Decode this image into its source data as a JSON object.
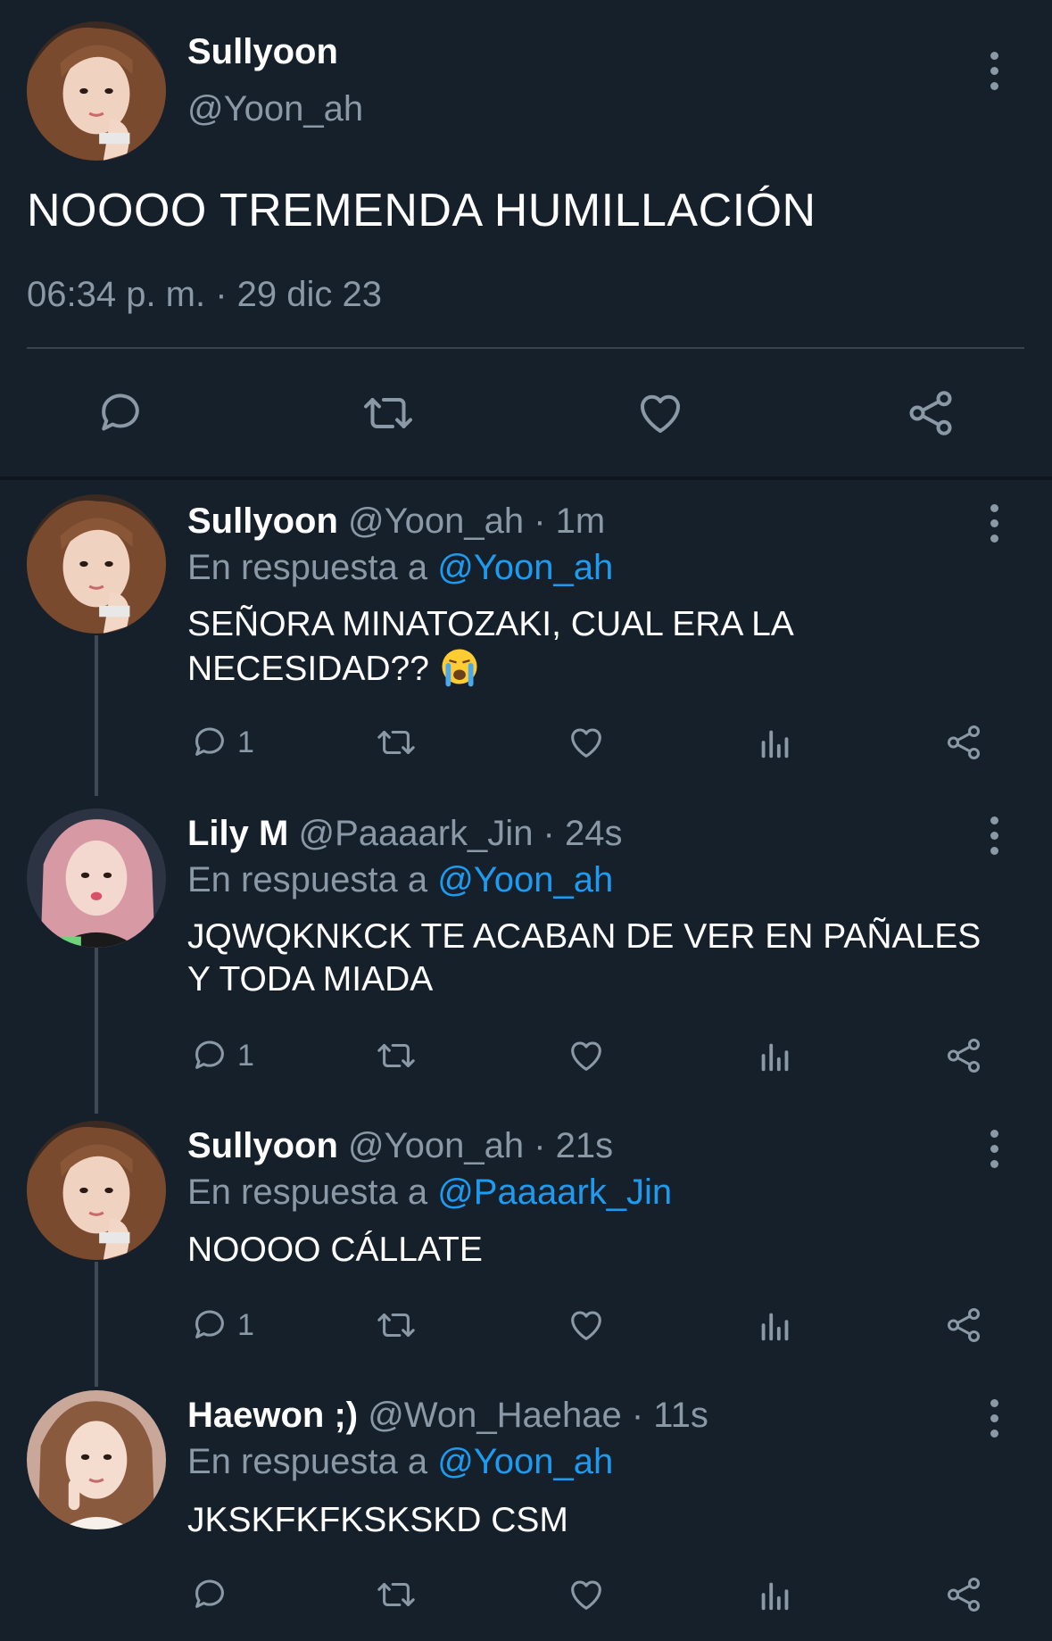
{
  "colors": {
    "background": "#15202b",
    "secondary_text": "#8b98a5",
    "link": "#1d9bf0",
    "divider": "#38444d"
  },
  "main_tweet": {
    "name": "Sullyoon",
    "handle": "@Yoon_ah",
    "text": "NOOOO TREMENDA HUMILLACIÓN",
    "timestamp": "06:34 p. m. · 29 dic 23",
    "actions": [
      "reply-icon",
      "retweet-icon",
      "like-icon",
      "share-icon"
    ]
  },
  "replies": [
    {
      "name": "Sullyoon",
      "handle_time": "@Yoon_ah · 1m",
      "reply_prefix": "En respuesta a",
      "reply_to": "@Yoon_ah",
      "text_line1": "SEÑORA MINATOZAKI, CUAL ERA LA",
      "text_line2": "NECESIDAD??",
      "emoji": "loudly-crying-face",
      "reply_count": "1"
    },
    {
      "name": "Lily M",
      "handle_time": "@Paaaark_Jin · 24s",
      "reply_prefix": "En respuesta a",
      "reply_to": "@Yoon_ah",
      "text_line1": "JQWQKNKCK TE ACABAN DE VER EN PAÑALES",
      "text_line2": "Y TODA MIADA",
      "reply_count": "1"
    },
    {
      "name": "Sullyoon",
      "handle_time": "@Yoon_ah · 21s",
      "reply_prefix": "En respuesta a",
      "reply_to": "@Paaaark_Jin",
      "text_line1": "NOOOO CÁLLATE",
      "reply_count": "1"
    },
    {
      "name": "Haewon ;)",
      "handle_time": "@Won_Haehae · 11s",
      "reply_prefix": "En respuesta a",
      "reply_to": "@Yoon_ah",
      "text_line1": "JKSKFKFKSKSKD CSM",
      "reply_count": ""
    }
  ]
}
